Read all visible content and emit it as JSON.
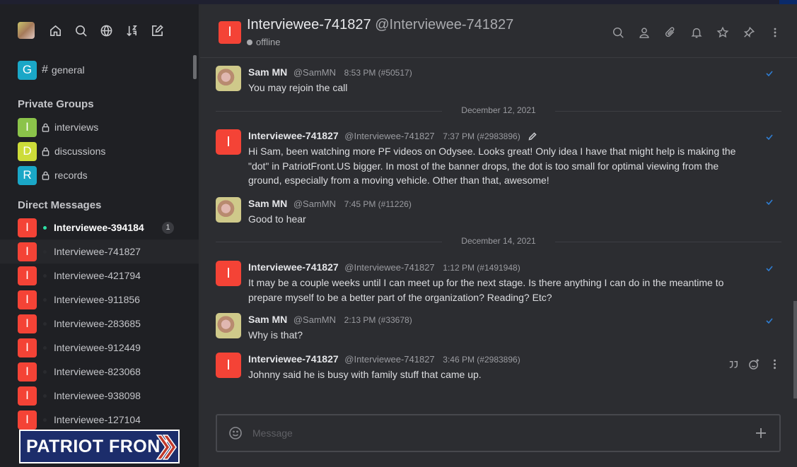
{
  "sidebar": {
    "channel": {
      "avatar": "G",
      "name": "general"
    },
    "private_title": "Private Groups",
    "groups": [
      {
        "avatar": "I",
        "name": "interviews"
      },
      {
        "avatar": "D",
        "name": "discussions"
      },
      {
        "avatar": "R",
        "name": "records"
      }
    ],
    "dm_title": "Direct Messages",
    "dms": [
      {
        "avatar": "I",
        "name": "Interviewee-394184",
        "badge": "1"
      },
      {
        "avatar": "I",
        "name": "Interviewee-741827"
      },
      {
        "avatar": "I",
        "name": "Interviewee-421794"
      },
      {
        "avatar": "I",
        "name": "Interviewee-911856"
      },
      {
        "avatar": "I",
        "name": "Interviewee-283685"
      },
      {
        "avatar": "I",
        "name": "Interviewee-912449"
      },
      {
        "avatar": "I",
        "name": "Interviewee-823068"
      },
      {
        "avatar": "I",
        "name": "Interviewee-938098"
      },
      {
        "avatar": "I",
        "name": "Interviewee-127104"
      }
    ],
    "logo_text": "PATRIOT FRONT"
  },
  "header": {
    "avatar": "I",
    "title": "Interviewee-741827",
    "handle": "@Interviewee-741827",
    "status": "offline"
  },
  "messages": [
    {
      "name": "Sam MN",
      "handle": "@SamMN",
      "time": "8:53 PM (#50517)",
      "text": "You may rejoin the call"
    },
    {
      "name": "Interviewee-741827",
      "handle": "@Interviewee-741827",
      "time": "7:37 PM (#2983896)",
      "text": "Hi Sam, been watching more PF videos on Odysee. Looks great! Only idea I have that might help is making the \"dot\" in PatriotFront.US bigger. In most of the banner drops, the dot is too small for optimal viewing from the ground, especially from a moving vehicle. Other than that, awesome!"
    },
    {
      "name": "Sam MN",
      "handle": "@SamMN",
      "time": "7:45 PM (#11226)",
      "text": "Good to hear"
    },
    {
      "name": "Interviewee-741827",
      "handle": "@Interviewee-741827",
      "time": "1:12 PM (#1491948)",
      "text": "It may be a couple weeks until I can meet up for the next stage. Is there anything I can do in the meantime to prepare myself to be a better part of the organization? Reading? Etc?"
    },
    {
      "name": "Sam MN",
      "handle": "@SamMN",
      "time": "2:13 PM (#33678)",
      "text": "Why is that?"
    },
    {
      "name": "Interviewee-741827",
      "handle": "@Interviewee-741827",
      "time": "3:46 PM (#2983896)",
      "text": "Johnny said he is busy with family stuff that came up."
    }
  ],
  "dividers": [
    "December 12, 2021",
    "December 14, 2021"
  ],
  "composer": {
    "placeholder": "Message"
  },
  "colors": {
    "accent_red": "#f44336",
    "online": "#2de0a5",
    "check": "#2f7dd1"
  }
}
